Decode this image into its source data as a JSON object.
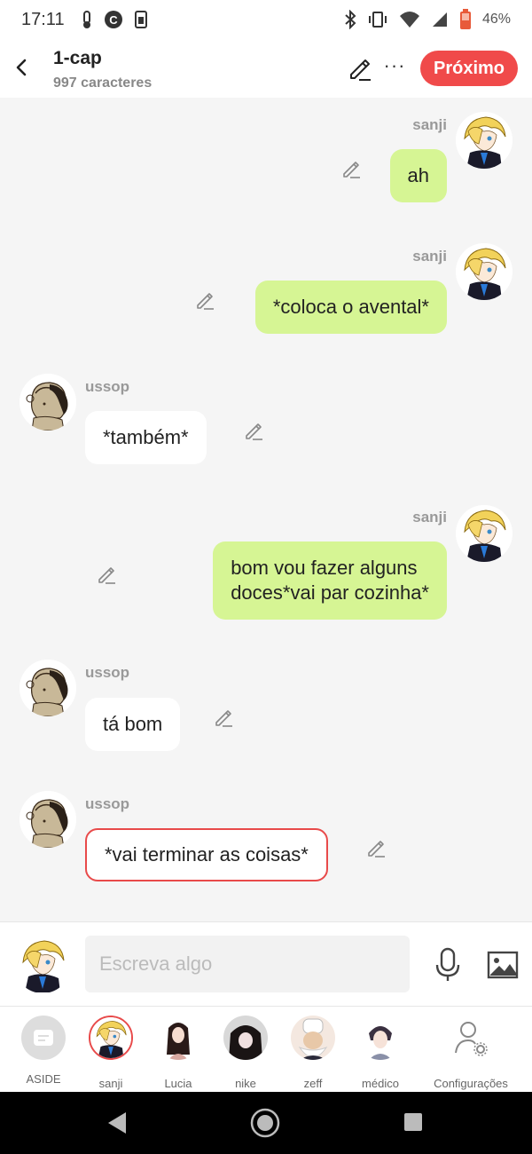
{
  "status_bar": {
    "time": "17:11",
    "battery": "46%",
    "left_icons": [
      "thermometer-icon",
      "c-app-icon",
      "sim-icon"
    ],
    "right_icons": [
      "bluetooth-icon",
      "vibrate-icon",
      "wifi-icon",
      "signal-icon",
      "battery-icon"
    ]
  },
  "header": {
    "title": "1-cap",
    "subtitle": "997 caracteres",
    "more_label": "···",
    "next_label": "Próximo",
    "accent_color": "#f04a4a"
  },
  "messages": [
    {
      "sender": "sanji",
      "text": "ah",
      "side": "right"
    },
    {
      "sender": "sanji",
      "text": "*coloca o avental*",
      "side": "right"
    },
    {
      "sender": "ussop",
      "text": "*também*",
      "side": "left"
    },
    {
      "sender": "sanji",
      "text_lines": [
        "bom vou fazer alguns",
        "doces*vai  par cozinha*"
      ],
      "side": "right"
    },
    {
      "sender": "ussop",
      "text": "tá bom",
      "side": "left"
    },
    {
      "sender": "ussop",
      "text": "*vai terminar as coisas*",
      "side": "left",
      "selected": true
    }
  ],
  "input": {
    "placeholder": "Escreva algo"
  },
  "characters": [
    {
      "label": "ASIDE"
    },
    {
      "label": "sanji",
      "selected": true
    },
    {
      "label": "Lucia"
    },
    {
      "label": "nike"
    },
    {
      "label": "zeff"
    },
    {
      "label": "médico"
    },
    {
      "label": "Configurações"
    }
  ],
  "colors": {
    "right_bubble": "#d6f594",
    "left_bubble": "#ffffff",
    "background": "#f5f5f5"
  }
}
